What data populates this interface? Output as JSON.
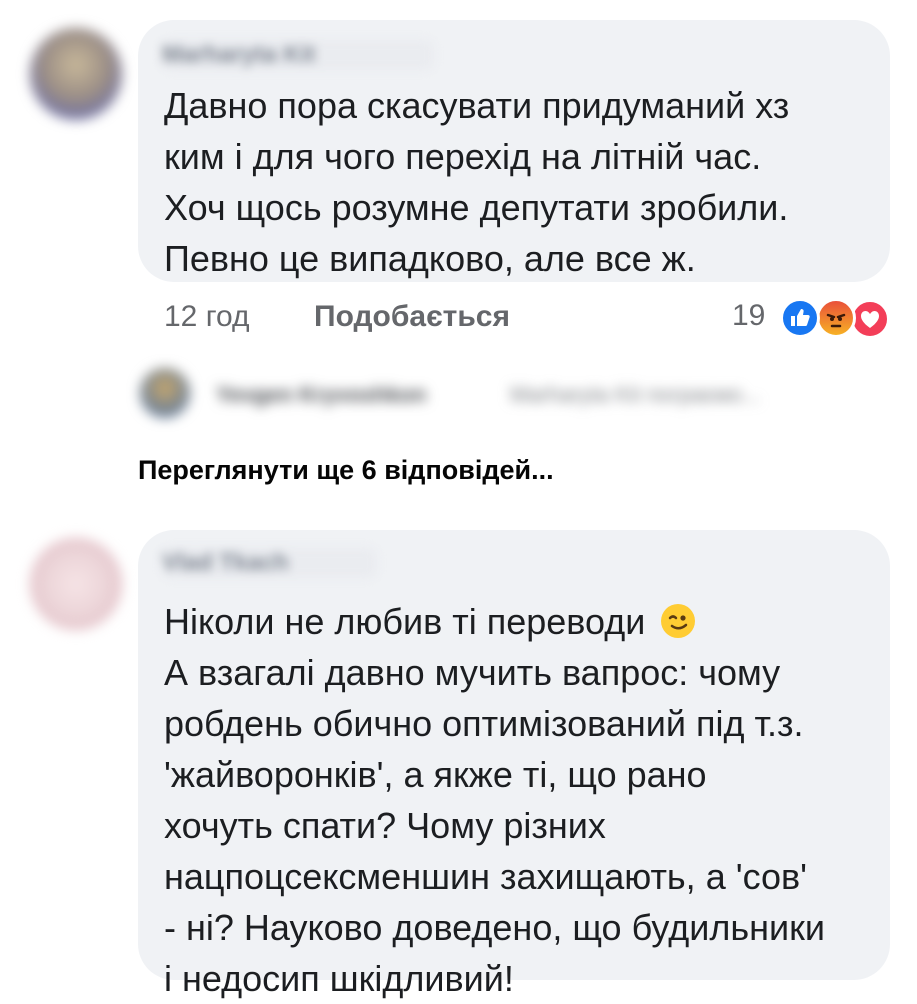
{
  "comments": [
    {
      "author": "Marharyta Kit",
      "lines": [
        "Давно пора скасувати придуманий хз",
        "ким і для чого перехід на літній час.",
        "Хоч щось розумне депутати зробили.",
        "Певно це випадково, але все ж."
      ],
      "time": "12 год",
      "like_label": "Подобається",
      "reaction_count": "19",
      "reactions": [
        "like-icon",
        "angry-icon",
        "love-icon"
      ],
      "reaction_colors": {
        "like": "#1877f2",
        "angry": "#f0633c",
        "love": "#f33e58"
      }
    },
    {
      "author": "Vlad Tkach",
      "lines": [
        "Ніколи не любив ті переводи",
        "А взагалі давно мучить вапрос: чому",
        "робдень обично оптимізований під т.з.",
        "'жайворонків', а якже ті, що рано",
        "хочуть спати? Чому різних",
        "нацпоцсексменшин захищають, а 'сов'",
        "- ні? Науково доведено, що будильники",
        "і недосип шкідливий!"
      ],
      "emoji": "wink-emoji"
    }
  ],
  "reply_preview": {
    "author": "Yevgen Kryvoshkon",
    "text": "Marharyta Kit пограємо..."
  },
  "view_more_label": "Переглянути ще 6 відповідей..."
}
